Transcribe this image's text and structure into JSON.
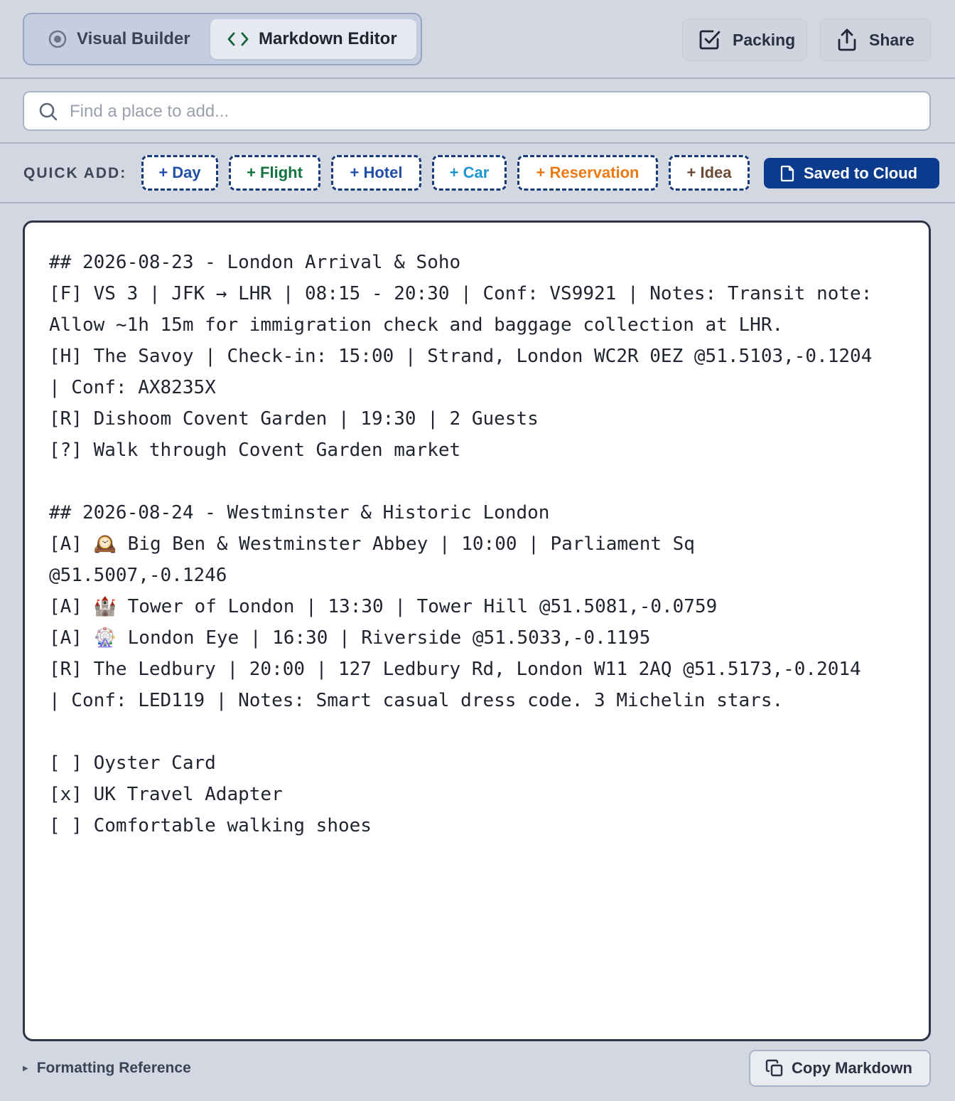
{
  "header": {
    "modes": [
      {
        "label": "Visual Builder",
        "icon": "target-icon",
        "active": false
      },
      {
        "label": "Markdown Editor",
        "icon": "code-icon",
        "active": true
      }
    ],
    "actions": {
      "packing_label": "Packing",
      "share_label": "Share"
    }
  },
  "search": {
    "placeholder": "Find a place to add...",
    "value": ""
  },
  "quick_add": {
    "label": "QUICK ADD:",
    "chips": [
      {
        "label": "+ Day",
        "color": "#1f4fa8"
      },
      {
        "label": "+ Flight",
        "color": "#12733f"
      },
      {
        "label": "+ Hotel",
        "color": "#1f4fa8"
      },
      {
        "label": "+ Car",
        "color": "#1b96cf"
      },
      {
        "label": "+ Reservation",
        "color": "#ea7a13"
      },
      {
        "label": "+ Idea",
        "color": "#6b4a35"
      }
    ],
    "saved_label": "Saved to Cloud"
  },
  "editor": {
    "lines": [
      "## 2026-08-23 - London Arrival & Soho",
      "[F] VS 3 | JFK → LHR | 08:15 - 20:30 | Conf: VS9921 | Notes: Transit note:",
      "Allow ~1h 15m for immigration check and baggage collection at LHR.",
      "[H] The Savoy | Check-in: 15:00 | Strand, London WC2R 0EZ @51.5103,-0.1204",
      "| Conf: AX8235X",
      "[R] Dishoom Covent Garden | 19:30 | 2 Guests",
      "[?] Walk through Covent Garden market",
      "",
      "## 2026-08-24 - Westminster & Historic London",
      "[A] 🕰️ Big Ben & Westminster Abbey | 10:00 | Parliament Sq",
      "@51.5007,-0.1246",
      "[A] 🏰 Tower of London | 13:30 | Tower Hill @51.5081,-0.0759",
      "[A] 🎡 London Eye | 16:30 | Riverside @51.5033,-0.1195",
      "[R] The Ledbury | 20:00 | 127 Ledbury Rd, London W11 2AQ @51.5173,-0.2014",
      "| Conf: LED119 | Notes: Smart casual dress code. 3 Michelin stars.",
      "",
      "[ ] Oyster Card",
      "[x] UK Travel Adapter",
      "[ ] Comfortable walking shoes"
    ]
  },
  "footer": {
    "reference_label": "Formatting Reference",
    "copy_label": "Copy Markdown"
  },
  "colors": {
    "background": "#d3d7e1",
    "primary": "#0a3b8c",
    "chip_border": "#193a78"
  }
}
